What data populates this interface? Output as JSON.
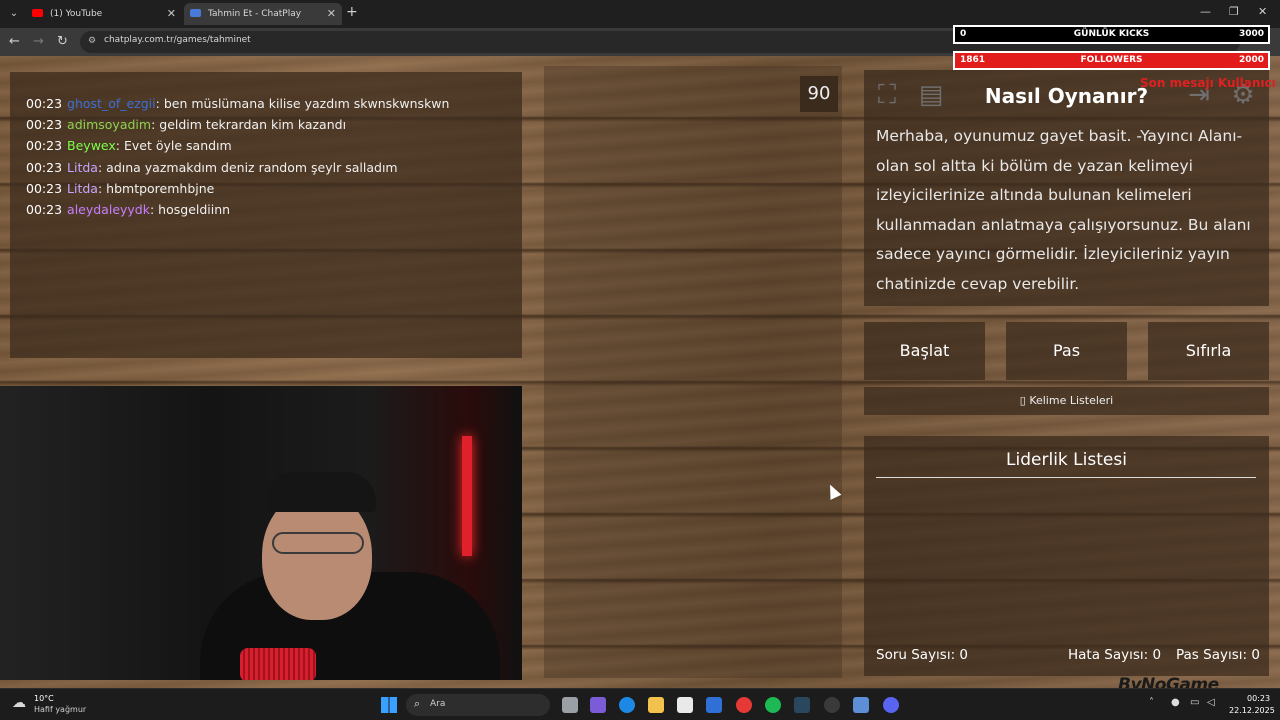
{
  "browser": {
    "tabs": [
      {
        "label": "(1) YouTube"
      },
      {
        "label": "Tahmin Et - ChatPlay"
      }
    ],
    "url": "chatplay.com.tr/games/tahminet"
  },
  "chat": {
    "messages": [
      {
        "time": "00:23",
        "user": "ghost_of_ezgii",
        "color": "#3b6fd6",
        "text": "ben müslümana kilise yazdım skwnskwnskwn"
      },
      {
        "time": "00:23",
        "user": "adimsoyadim",
        "color": "#8fd14f",
        "text": "geldim tekrardan kim kazandı"
      },
      {
        "time": "00:23",
        "user": "Beywex",
        "color": "#7cff4a",
        "text": "Evet öyle sandım"
      },
      {
        "time": "00:23",
        "user": "Litda",
        "color": "#c7a6ff",
        "text": "adına yazmakdım deniz random şeylr salladım"
      },
      {
        "time": "00:23",
        "user": "Litda",
        "color": "#c7a6ff",
        "text": "hbmtporemhbjne"
      },
      {
        "time": "00:23",
        "user": "aleydaleyydk",
        "color": "#c77dff",
        "text": "hosgeldiinn"
      }
    ]
  },
  "timer": "90",
  "how_to": {
    "title": "Nasıl Oynanır?",
    "text": "Merhaba, oyunumuz gayet basit. -Yayıncı Alanı- olan sol altta ki bölüm de yazan kelimeyi izleyicilerinize altında bulunan kelimeleri kullanmadan anlatmaya çalışıyorsunuz. Bu alanı sadece yayıncı görmelidir. İzleyicileriniz yayın chatinizde cevap verebilir."
  },
  "controls": {
    "start": "Başlat",
    "pass": "Pas",
    "reset": "Sıfırla",
    "word_lists": "Kelime Listeleri"
  },
  "leaderboard": {
    "title": "Liderlik Listesi",
    "question_count": "Soru Sayısı: 0",
    "error_count": "Hata Sayısı: 0",
    "pass_count": "Pas Sayısı: 0"
  },
  "overlay": {
    "kicks": {
      "current": "0",
      "label": "GÜNLÜK KICKS",
      "goal": "3000"
    },
    "followers": {
      "current": "1861",
      "label": "FOLLOWERS",
      "goal": "2000"
    },
    "alert": "Son mesajı Kullanıcı",
    "sponsor": "ByNoGame"
  },
  "taskbar": {
    "weather_temp": "10°C",
    "weather_desc": "Hafif yağmur",
    "search_placeholder": "Ara",
    "time": "00:23",
    "date": "22.12.2025"
  },
  "colors": {
    "panel": "#3a2a1c",
    "wood": "#7a5a3c",
    "follow_bar": "#e21b1b",
    "youtube_red": "#ff0000"
  },
  "icons": [
    "fullscreen-icon",
    "notebook-icon",
    "logout-icon",
    "gear-icon",
    "search-icon",
    "windows-icon"
  ]
}
